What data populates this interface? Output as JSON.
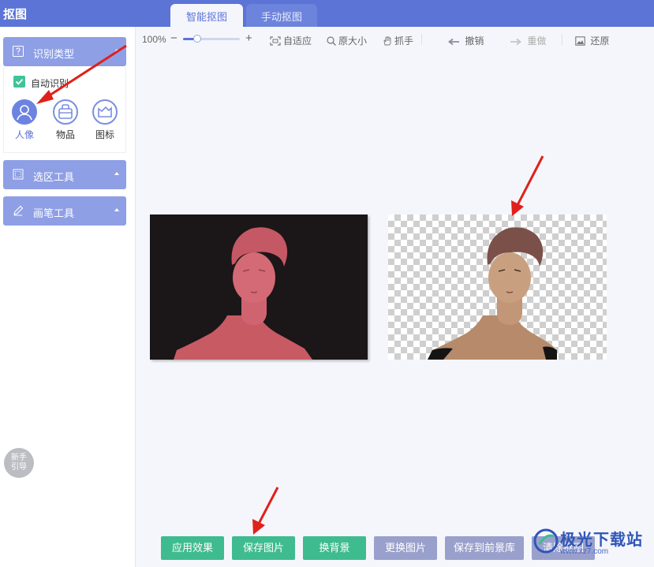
{
  "app": {
    "title": "抠图"
  },
  "tabs": [
    {
      "label": "智能抠图",
      "active": true
    },
    {
      "label": "手动抠图",
      "active": false
    }
  ],
  "sidebar": {
    "recognition": {
      "title": "识别类型",
      "auto_label": "自动识别",
      "auto_checked": true,
      "types": [
        {
          "label": "人像",
          "icon": "person-icon",
          "active": true
        },
        {
          "label": "物品",
          "icon": "bag-icon",
          "active": false
        },
        {
          "label": "图标",
          "icon": "image-icon",
          "active": false
        }
      ]
    },
    "selection_tool": {
      "title": "选区工具"
    },
    "brush_tool": {
      "title": "画笔工具"
    },
    "guide": {
      "line1": "新手",
      "line2": "引导"
    }
  },
  "toolbar": {
    "zoom_label": "100%",
    "zoom_level": 0.25,
    "fit_label": "自适应",
    "original_label": "原大小",
    "grab_label": "抓手",
    "undo_label": "撤销",
    "redo_label": "重做",
    "restore_label": "还原"
  },
  "bottom_buttons": {
    "apply": "应用效果",
    "save_image": "保存图片",
    "change_background": "换背景",
    "replace_image": "更换图片",
    "save_to_foreground": "保存到前景库",
    "clear": "清除抠图"
  },
  "watermark": {
    "text": "极光下载站",
    "sub": "www.xz7.com"
  },
  "colors": {
    "primary": "#5b74d6",
    "sidebar_header": "#8e9fe6",
    "green_button": "#3fbc8f",
    "purple_button": "#9aa0cc",
    "arrow": "#e0201b"
  }
}
